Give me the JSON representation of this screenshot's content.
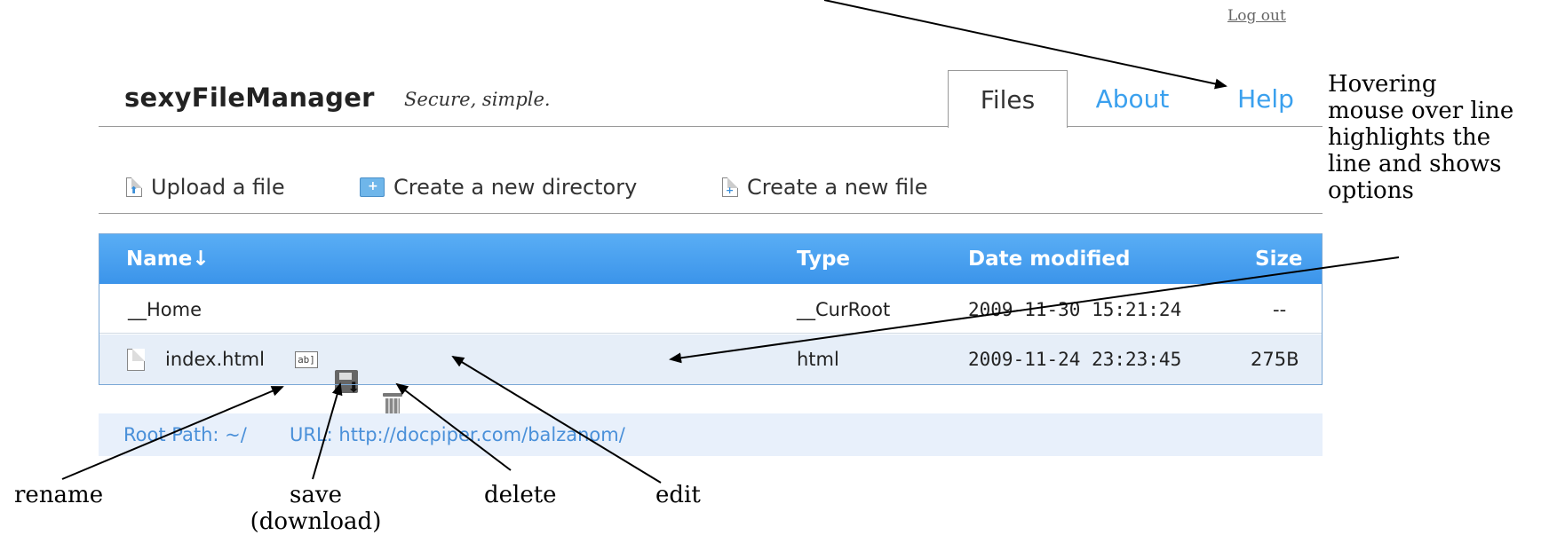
{
  "top": {
    "logout": "Log out"
  },
  "header": {
    "brand": "sexyFileManager",
    "tagline": "Secure, simple.",
    "tabs": [
      {
        "label": "Files",
        "active": true
      },
      {
        "label": "About",
        "active": false
      },
      {
        "label": "Help",
        "active": false
      }
    ]
  },
  "toolbar": {
    "upload": "Upload a file",
    "new_dir": "Create a new directory",
    "new_file": "Create a new file"
  },
  "table": {
    "headers": {
      "name": "Name↓",
      "type": "Type",
      "date": "Date modified",
      "size": "Size"
    },
    "rows": [
      {
        "name": "__Home",
        "type": "__CurRoot",
        "date": "2009-11-30 15:21:24",
        "size": "--"
      },
      {
        "name": "index.html",
        "type": "html",
        "date": "2009-11-24 23:23:45",
        "size": "275B",
        "hover": true
      }
    ]
  },
  "footer": {
    "root_path": "Root Path: ~/",
    "url": "URL: http://docpiper.com/balzanom/"
  },
  "annotations": {
    "hover_note_lines": [
      "Hovering",
      "mouse over line",
      "highlights the",
      "line and shows",
      "options"
    ],
    "rename": "rename",
    "save_lines": [
      "save",
      "(download)"
    ],
    "delete": "delete",
    "edit": "edit"
  },
  "colors": {
    "header_blue": "#3b94ea",
    "link_blue": "#3aa0ee",
    "row_hover": "#e6eef8",
    "footer_bg": "#e8f0fb"
  }
}
